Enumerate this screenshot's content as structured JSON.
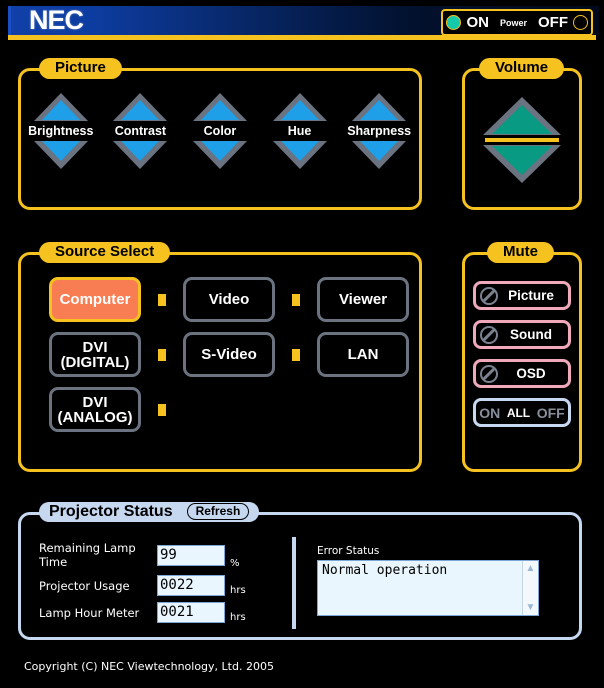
{
  "header": {
    "brand": "NEC",
    "power": {
      "on_label": "ON",
      "power_label": "Power",
      "off_label": "OFF",
      "on_state": true,
      "off_state": false,
      "on_led_color": "#16c9ab",
      "border_color": "#f5c21f"
    }
  },
  "picture": {
    "legend": "Picture",
    "accent": "#f5c21f",
    "triangle_fill": "#1e9fe8",
    "triangle_outline": "#6b7280",
    "items": [
      {
        "label": "Brightness",
        "up_icon": "triangle-up-icon",
        "down_icon": "triangle-down-icon"
      },
      {
        "label": "Contrast",
        "up_icon": "triangle-up-icon",
        "down_icon": "triangle-down-icon"
      },
      {
        "label": "Color",
        "up_icon": "triangle-up-icon",
        "down_icon": "triangle-down-icon"
      },
      {
        "label": "Hue",
        "up_icon": "triangle-up-icon",
        "down_icon": "triangle-down-icon"
      },
      {
        "label": "Sharpness",
        "up_icon": "triangle-up-icon",
        "down_icon": "triangle-down-icon"
      }
    ]
  },
  "volume": {
    "legend": "Volume",
    "up_icon": "triangle-up-icon",
    "down_icon": "triangle-down-icon",
    "triangle_fill": "#089a82",
    "triangle_outline": "#6b7280",
    "divider_color": "#f5c21f"
  },
  "source_select": {
    "legend": "Source Select",
    "selected": "Computer",
    "selected_bg": "#f97d52",
    "selected_border": "#f5c21f",
    "button_border": "#6b7280",
    "separator_color": "#f5c21f",
    "rows": [
      [
        {
          "label": "Computer",
          "selected": true
        },
        {
          "label": "Video",
          "selected": false
        },
        {
          "label": "Viewer",
          "selected": false
        }
      ],
      [
        {
          "label": "DVI\n(DIGITAL)",
          "selected": false
        },
        {
          "label": "S-Video",
          "selected": false
        },
        {
          "label": "LAN",
          "selected": false
        }
      ],
      [
        {
          "label": "DVI\n(ANALOG)",
          "selected": false
        }
      ]
    ]
  },
  "mute": {
    "legend": "Mute",
    "border_color": "#f0a8bb",
    "items": [
      {
        "label": "Picture",
        "icon": "no-entry-icon"
      },
      {
        "label": "Sound",
        "icon": "no-entry-icon"
      },
      {
        "label": "OSD",
        "icon": "no-entry-icon"
      }
    ],
    "all_row": {
      "on_label": "ON",
      "all_label": "ALL",
      "off_label": "OFF",
      "border_color": "#c6d8f0"
    }
  },
  "projector_status": {
    "legend": "Projector Status",
    "refresh_label": "Refresh",
    "panel_border": "#c6d8f0",
    "fields": [
      {
        "label": "Remaining Lamp Time",
        "value": "99",
        "unit": "%"
      },
      {
        "label": "Projector Usage",
        "value": "0022",
        "unit": "hrs"
      },
      {
        "label": "Lamp Hour Meter",
        "value": "0021",
        "unit": "hrs"
      }
    ],
    "error_status": {
      "label": "Error Status",
      "value": "Normal operation",
      "scroll_up_icon": "chevron-up-icon",
      "scroll_down_icon": "chevron-down-icon"
    }
  },
  "footer": {
    "copyright": "Copyright (C) NEC Viewtechnology, Ltd. 2005"
  }
}
